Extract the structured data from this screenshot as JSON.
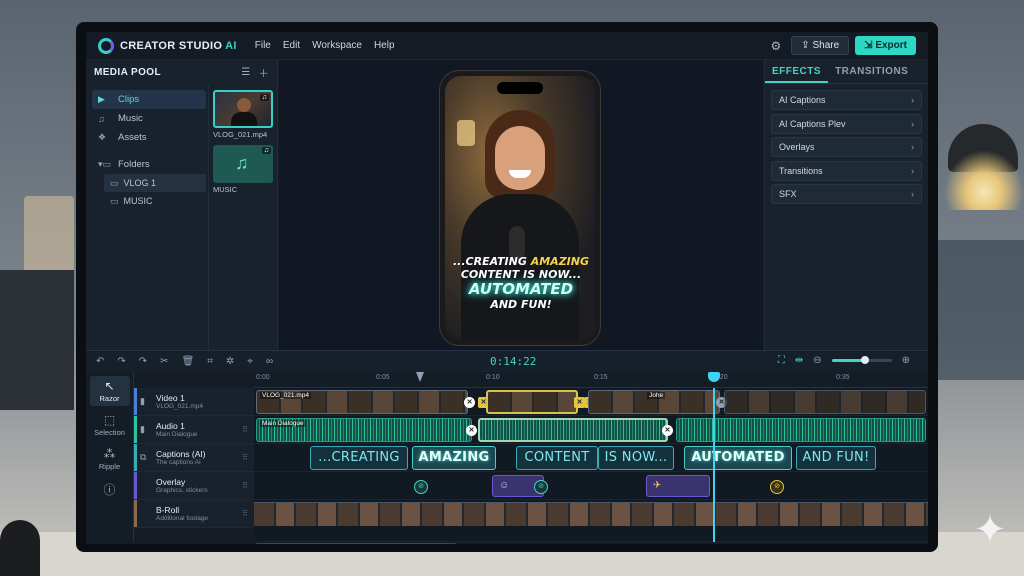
{
  "app": {
    "title_main": "CREATOR STUDIO",
    "title_ai": "AI"
  },
  "menu": [
    "File",
    "Edit",
    "Workspace",
    "Help"
  ],
  "header_actions": {
    "share": "Share",
    "export": "Export"
  },
  "media_pool": {
    "title": "MEDIA POOL",
    "nav": [
      "Clips",
      "Music",
      "Assets"
    ],
    "folders_label": "Folders",
    "folders": [
      "VLOG 1",
      "MUSIC"
    ],
    "thumbs": [
      {
        "label": "VLOG_021.mp4",
        "icon": "person-video-thumb"
      },
      {
        "label": "MUSIC",
        "icon": "music-note-icon"
      }
    ]
  },
  "preview": {
    "caption_line1_a": "...CREATING ",
    "caption_line1_b": "AMAZING",
    "caption_line2": "CONTENT IS NOW...",
    "caption_line3": "AUTOMATED",
    "caption_line4": "AND FUN!"
  },
  "effects_panel": {
    "tabs": [
      "EFFECTS",
      "TRANSITIONS"
    ],
    "active_tab": "EFFECTS",
    "items": [
      "AI Captions",
      "AI Captions Plev",
      "Overlays",
      "Transitions",
      "SFX"
    ]
  },
  "timeline": {
    "timecode": "0:14:22",
    "ruler": [
      "0:00",
      "0:05",
      "0:10",
      "0:15",
      "0:20",
      "0:35"
    ],
    "zoom_level": 0.55,
    "tools": [
      "Razor",
      "Selection",
      "Ripple"
    ],
    "tracks": [
      {
        "name": "Video 1",
        "sub": "VLOG_021.mp4"
      },
      {
        "name": "Audio 1",
        "sub": "Main Dialogue"
      },
      {
        "name": "Captions (AI)",
        "sub": "The captions AI"
      },
      {
        "name": "Overlay",
        "sub": "Graphics, stickers"
      },
      {
        "name": "B-Roll",
        "sub": "Additional footage"
      }
    ],
    "video_clip_label": "VLOG_021.mp4",
    "video_clip_label2": "Johe",
    "audio_clip_label": "Main Dialogue",
    "captions": [
      "...CREATING",
      "AMAZING",
      "CONTENT",
      "IS NOW...",
      "AUTOMATED",
      "AND FUN!"
    ],
    "highlighted_captions": [
      "AMAZING",
      "AUTOMATED"
    ]
  },
  "colors": {
    "accent": "#36d1c4",
    "playhead": "#3ed4f2",
    "selection": "#d8c24a"
  }
}
